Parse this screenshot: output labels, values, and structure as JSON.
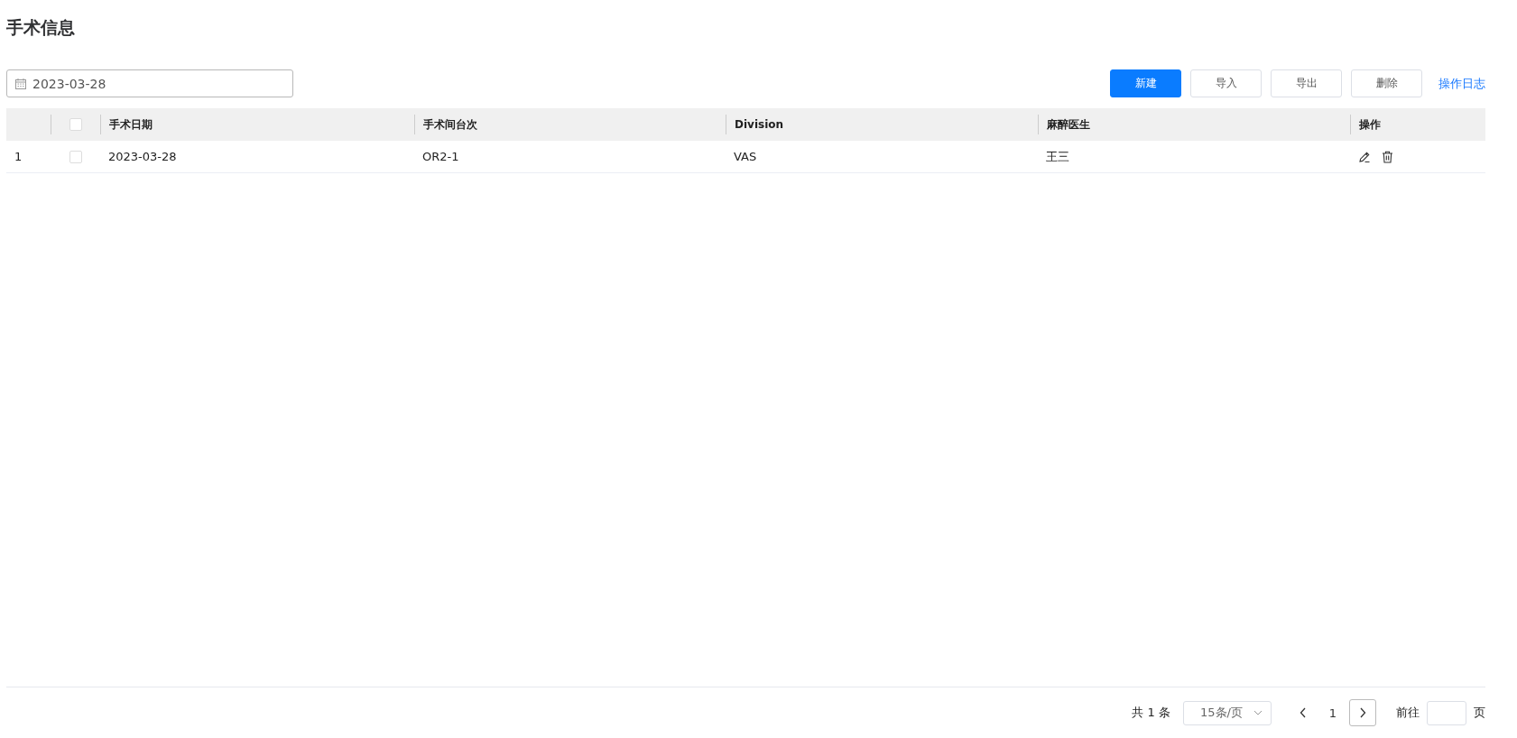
{
  "page_title": "手术信息",
  "date_filter": {
    "value": "2023-03-28"
  },
  "toolbar": {
    "buttons": [
      {
        "label": "新建",
        "kind": "primary"
      },
      {
        "label": "导入",
        "kind": "default"
      },
      {
        "label": "导出",
        "kind": "default"
      },
      {
        "label": "删除",
        "kind": "default"
      }
    ],
    "link": "操作日志"
  },
  "table": {
    "select_all": {
      "checked": false
    },
    "columns": [
      "手术日期",
      "手术间台次",
      "Division",
      "麻醉医生",
      "操作"
    ],
    "rows": [
      {
        "index": "1",
        "checked": false,
        "cells": [
          "2023-03-28",
          "OR2-1",
          "VAS",
          "王三"
        ]
      }
    ]
  },
  "pagination": {
    "total": "共 1 条",
    "page_size": "15条/页",
    "pages": [
      {
        "label": "1",
        "selected": true
      }
    ],
    "goto_label": "前往",
    "goto_suffix": "页"
  }
}
